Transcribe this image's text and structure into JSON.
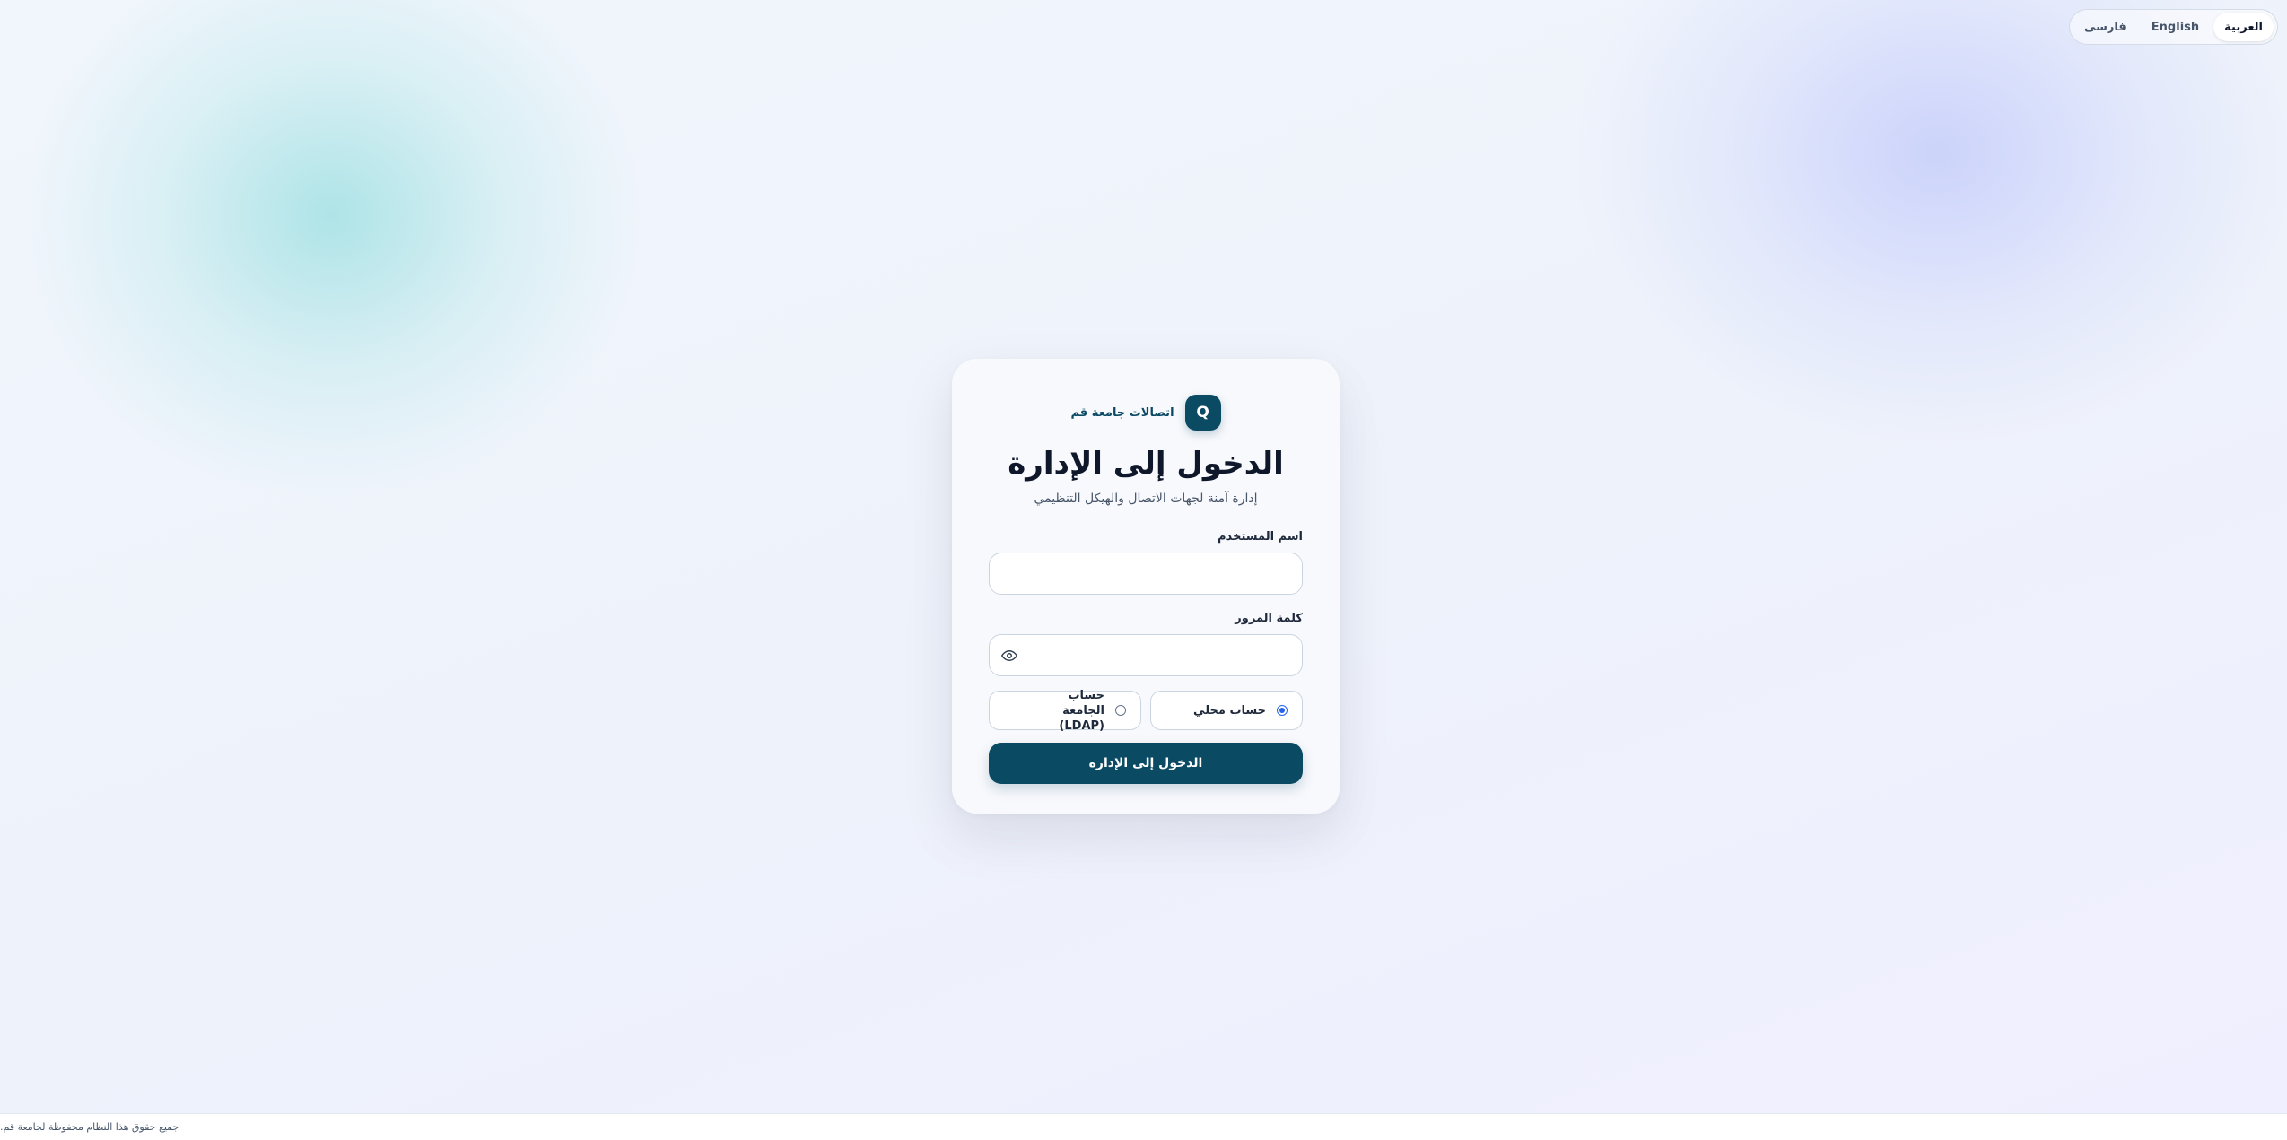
{
  "language_switcher": {
    "options": [
      {
        "label": "العربية",
        "active": true
      },
      {
        "label": "English",
        "active": false
      },
      {
        "label": "فارسی",
        "active": false
      }
    ]
  },
  "brand": {
    "logo_letter": "Q",
    "name": "اتصالات جامعة قم"
  },
  "login": {
    "title": "الدخول إلى الإدارة",
    "subtitle": "إدارة آمنة لجهات الاتصال والهيكل التنظيمي",
    "username_label": "اسم المستخدم",
    "username_value": "",
    "password_label": "كلمة المرور",
    "password_value": "",
    "auth_options": [
      {
        "label": "حساب محلي",
        "selected": true
      },
      {
        "label": "حساب الجامعة (LDAP)",
        "selected": false
      }
    ],
    "submit_label": "الدخول إلى الإدارة"
  },
  "footer": {
    "text": "جميع حقوق هذا النظام محفوظة لجامعة قم."
  },
  "colors": {
    "primary": "#0b4a63",
    "radio_accent": "#2563eb",
    "background": "#eef3fb"
  },
  "icons": {
    "password_toggle": "eye-icon"
  }
}
